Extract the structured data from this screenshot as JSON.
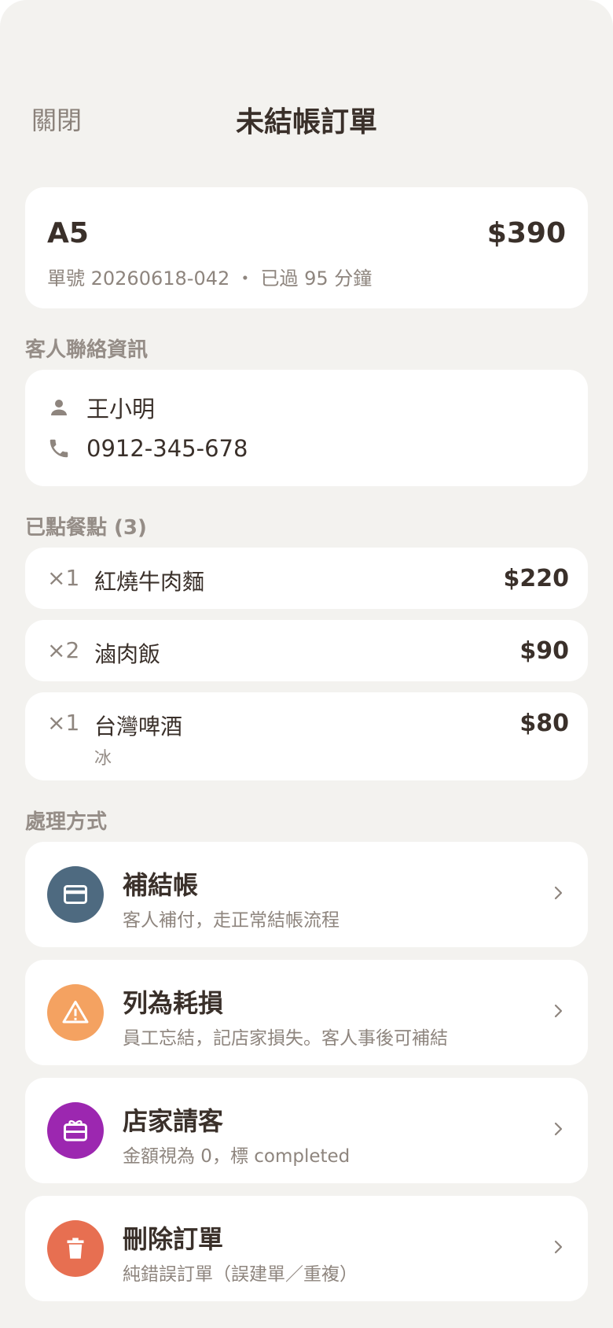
{
  "header": {
    "close_label": "關閉",
    "title": "未結帳訂單"
  },
  "summary": {
    "table": "A5",
    "total": "$390",
    "meta": "單號 20260618-042 ・ 已過 95 分鐘"
  },
  "contact": {
    "section_label": "客人聯絡資訊",
    "name": "王小明",
    "phone": "0912-345-678",
    "name_icon": "person-icon",
    "phone_icon": "phone-icon"
  },
  "items": {
    "section_label": "已點餐點 (3)",
    "list": [
      {
        "qty": "×1",
        "name": "紅燒牛肉麵",
        "price": "$220",
        "note": ""
      },
      {
        "qty": "×2",
        "name": "滷肉飯",
        "price": "$90",
        "note": ""
      },
      {
        "qty": "×1",
        "name": "台灣啤酒",
        "price": "$80",
        "note": "冰"
      }
    ]
  },
  "actions": {
    "section_label": "處理方式",
    "list": [
      {
        "title": "補結帳",
        "desc": "客人補付，走正常結帳流程",
        "icon": "credit-card-icon",
        "color": "#4e6a80"
      },
      {
        "title": "列為耗損",
        "desc": "員工忘結，記店家損失。客人事後可補結",
        "icon": "warning-icon",
        "color": "#f4a261"
      },
      {
        "title": "店家請客",
        "desc": "金額視為 0，標 completed",
        "icon": "gift-card-icon",
        "color": "#9c27b0"
      },
      {
        "title": "刪除訂單",
        "desc": "純錯誤訂單（誤建單／重複）",
        "icon": "trash-icon",
        "color": "#e76f51"
      }
    ]
  },
  "colors": {
    "background": "#f3f2ef",
    "card": "#ffffff",
    "text_primary": "#3a302a",
    "text_secondary": "#8e857e"
  }
}
